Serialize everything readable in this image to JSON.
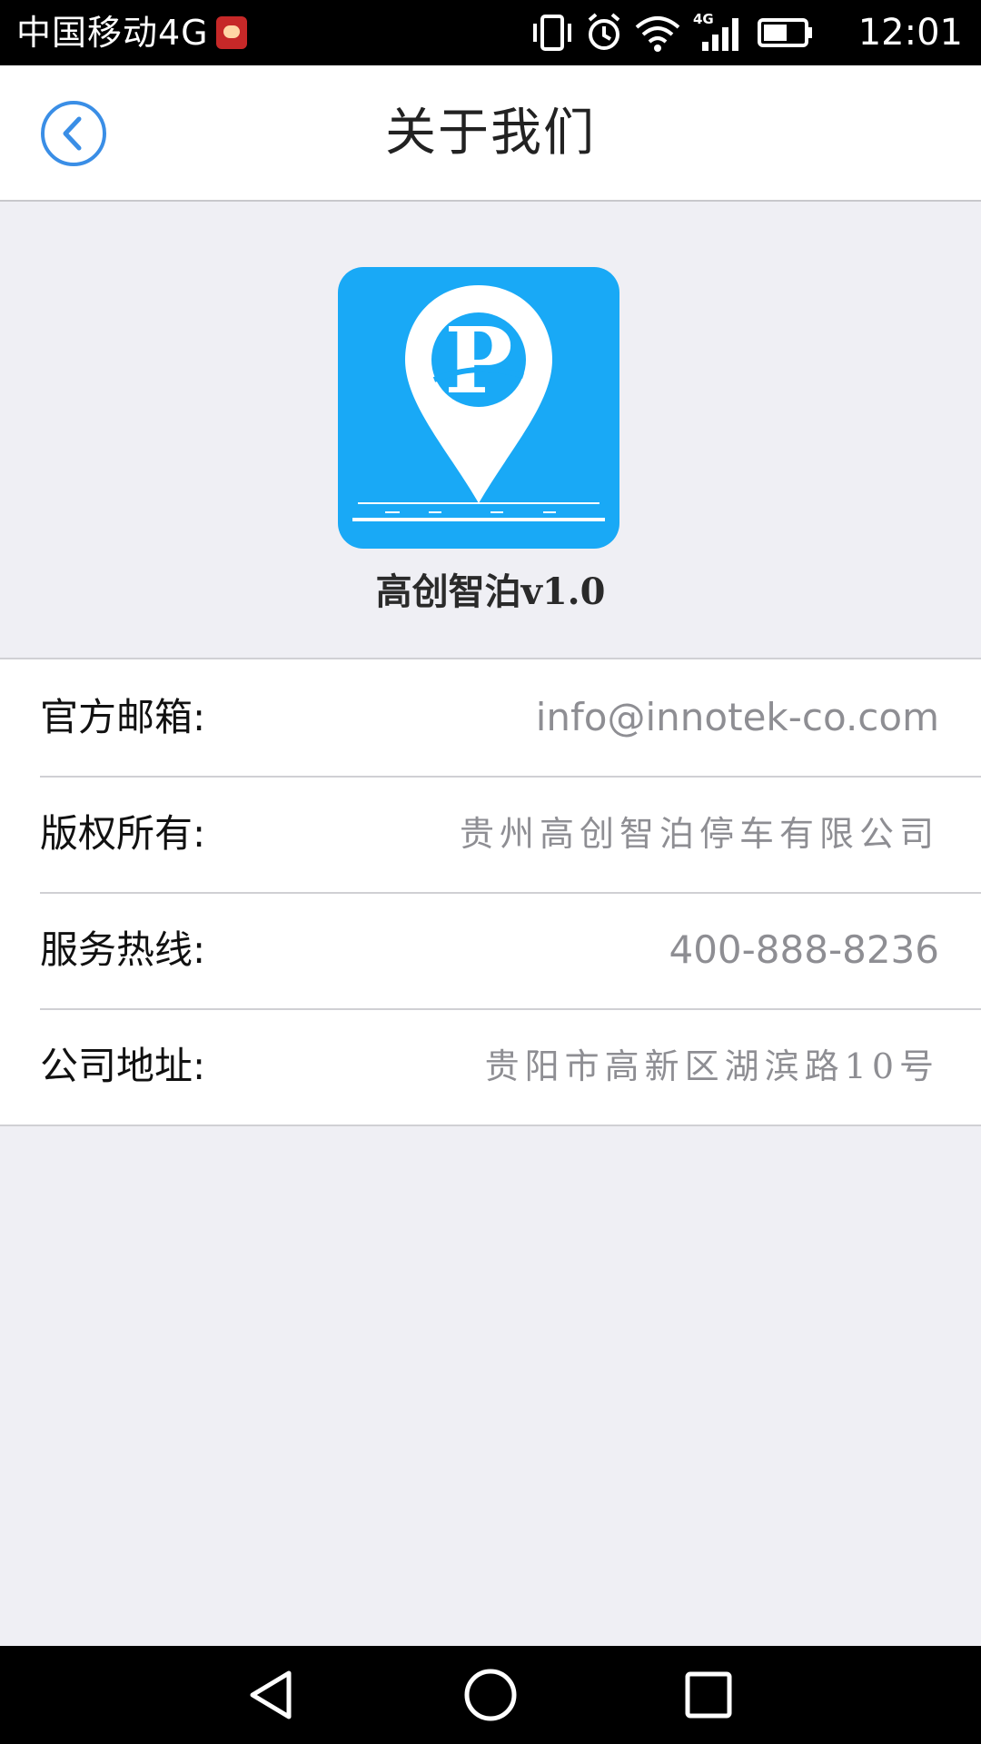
{
  "status_bar": {
    "carrier": "中国移动4G",
    "network_badge": "4G",
    "time": "12:01",
    "icons": [
      "app-notification-icon",
      "vibrate-icon",
      "alarm-icon",
      "wifi-icon",
      "signal-icon",
      "battery-icon"
    ],
    "battery_level": 0.6
  },
  "header": {
    "back_icon": "chevron-left-icon",
    "title": "关于我们"
  },
  "app": {
    "logo": "parking-pin-logo",
    "name": "高创智泊v1.0"
  },
  "info": {
    "rows": [
      {
        "label": "官方邮箱:",
        "value": "info@innotek-co.com"
      },
      {
        "label": "版权所有:",
        "value": "贵州高创智泊停车有限公司"
      },
      {
        "label": "服务热线:",
        "value": "400-888-8236"
      },
      {
        "label": "公司地址:",
        "value": "贵阳市高新区湖滨路10号"
      }
    ]
  },
  "nav_bar": {
    "icons": [
      "back-triangle-icon",
      "home-circle-icon",
      "recents-square-icon"
    ]
  },
  "colors": {
    "accent": "#3a8ee6",
    "logo_bg": "#19a9f6",
    "page_bg": "#efeff4",
    "value_text": "#8e8e93"
  }
}
